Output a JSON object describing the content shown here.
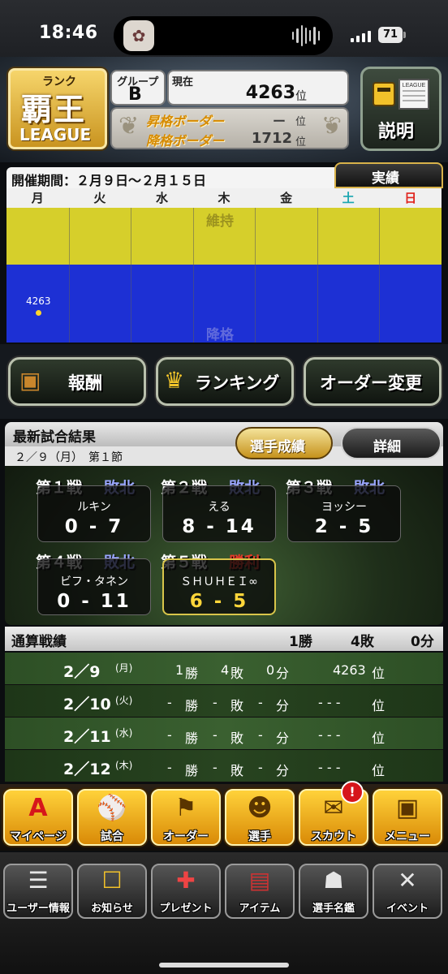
{
  "status_bar": {
    "time": "18:46",
    "battery": "71"
  },
  "rank": {
    "label": "ランク",
    "name": "覇王",
    "league": "LEAGUE"
  },
  "group": {
    "label": "グループ",
    "value": "B"
  },
  "current": {
    "label": "現在",
    "value": "4263",
    "unit": "位"
  },
  "borders": {
    "promotion_label": "昇格ボーダー",
    "promotion_value": "ー",
    "promotion_unit": "位",
    "demotion_label": "降格ボーダー",
    "demotion_value": "1712",
    "demotion_unit": "位"
  },
  "explain_button": {
    "icon_text": "LEAGUE",
    "label": "説明"
  },
  "schedule": {
    "period_text": "開催期間：２月９日～２月１５日",
    "results_tab": "実績",
    "weekdays": [
      "月",
      "火",
      "水",
      "木",
      "金",
      "土",
      "日"
    ],
    "weekday_colors": [
      "#222222",
      "#222222",
      "#222222",
      "#222222",
      "#222222",
      "#1aa6b0",
      "#e0241d"
    ],
    "maintain_label": "維持",
    "demote_label": "降格",
    "plot_value": "4263",
    "plot_day": "月"
  },
  "actions": {
    "rewards": "報酬",
    "ranking": "ランキング",
    "order_change": "オーダー変更"
  },
  "latest_results": {
    "title": "最新試合結果",
    "subtitle": "２／９（月）　第１節",
    "player_stats_button": "選手成績",
    "details_button": "詳細",
    "games": [
      {
        "label": "第１戦",
        "result": "敗北",
        "opponent": "ルキン",
        "score": "0 - 7",
        "won": false
      },
      {
        "label": "第２戦",
        "result": "敗北",
        "opponent": "える",
        "score": "8 - 14",
        "won": false
      },
      {
        "label": "第３戦",
        "result": "敗北",
        "opponent": "ヨッシー",
        "score": "2 - 5",
        "won": false
      },
      {
        "label": "第４戦",
        "result": "敗北",
        "opponent": "ビフ・タネン",
        "score": "0 - 11",
        "won": false
      },
      {
        "label": "第５戦",
        "result": "勝利",
        "opponent": "ＳＨＵＨＥＩ∞",
        "score": "6 - 5",
        "won": true
      }
    ],
    "colors": {
      "loss": "#9aa6ff",
      "win": "#e53a2a"
    }
  },
  "summary": {
    "title": "通算戦績",
    "wins": "1勝",
    "losses": "4敗",
    "draws": "0分",
    "rows": [
      {
        "date": "2／9",
        "dow": "(月)",
        "wins": "1",
        "losses": "4",
        "draws": "0",
        "rank": "4263",
        "rank_unit": "位"
      },
      {
        "date": "2／10",
        "dow": "(火)",
        "wins": "-",
        "losses": "-",
        "draws": "-",
        "rank": "- - -",
        "rank_unit": "位"
      },
      {
        "date": "2／11",
        "dow": "(水)",
        "wins": "-",
        "losses": "-",
        "draws": "-",
        "rank": "- - -",
        "rank_unit": "位"
      },
      {
        "date": "2／12",
        "dow": "(木)",
        "wins": "-",
        "losses": "-",
        "draws": "-",
        "rank": "- - -",
        "rank_unit": "位"
      }
    ],
    "win_suffix": "勝",
    "loss_suffix": "敗",
    "draw_suffix": "分"
  },
  "nav_main": [
    {
      "label": "マイページ",
      "icon": "A"
    },
    {
      "label": "試合",
      "icon": "⚾"
    },
    {
      "label": "オーダー",
      "icon": "⚑"
    },
    {
      "label": "選手",
      "icon": "☻"
    },
    {
      "label": "スカウト",
      "icon": "✉"
    },
    {
      "label": "メニュー",
      "icon": "▣"
    }
  ],
  "scout_badge": "!",
  "nav_sub": [
    {
      "label": "ユーザー情報",
      "icon": "☰"
    },
    {
      "label": "お知らせ",
      "icon": "☐"
    },
    {
      "label": "プレゼント",
      "icon": "✚"
    },
    {
      "label": "アイテム",
      "icon": "▤"
    },
    {
      "label": "選手名鑑",
      "icon": "☗"
    },
    {
      "label": "イベント",
      "icon": "✕"
    }
  ]
}
